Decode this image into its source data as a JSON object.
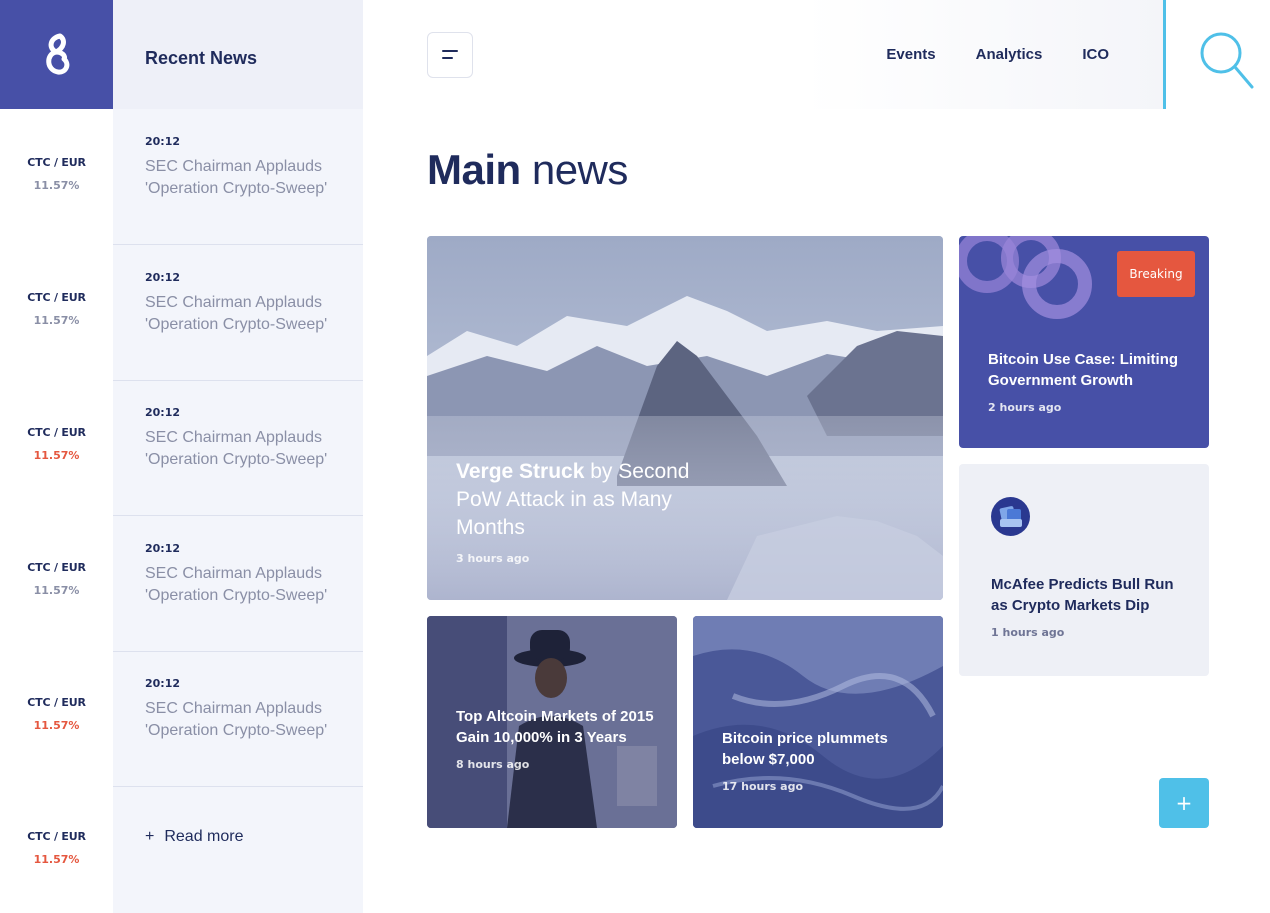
{
  "logo": {
    "icon": "logo-icon"
  },
  "ticker": [
    {
      "pair": "CTC / EUR",
      "change": "11.57%",
      "color": "#8a8fa6"
    },
    {
      "pair": "CTC / EUR",
      "change": "11.57%",
      "color": "#8a8fa6"
    },
    {
      "pair": "CTC / EUR",
      "change": "11.57%",
      "color": "#e5573f"
    },
    {
      "pair": "CTC / EUR",
      "change": "11.57%",
      "color": "#8a8fa6"
    },
    {
      "pair": "CTC / EUR",
      "change": "11.57%",
      "color": "#e5573f"
    },
    {
      "pair": "CTC / EUR",
      "change": "11.57%",
      "color": "#e5573f"
    }
  ],
  "recent": {
    "heading": "Recent News",
    "items": [
      {
        "time": "20:12",
        "title": "SEC Chairman Applauds 'Operation Crypto-Sweep'"
      },
      {
        "time": "20:12",
        "title": "SEC Chairman Applauds 'Operation Crypto-Sweep'"
      },
      {
        "time": "20:12",
        "title": "SEC Chairman Applauds 'Operation Crypto-Sweep'"
      },
      {
        "time": "20:12",
        "title": "SEC Chairman Applauds 'Operation Crypto-Sweep'"
      },
      {
        "time": "20:12",
        "title": "SEC Chairman Applauds 'Operation Crypto-Sweep'"
      }
    ],
    "read_more": "Read more",
    "read_more_symbol": "+"
  },
  "nav": {
    "items": [
      "Events",
      "Analytics",
      "ICO"
    ],
    "search_icon": "search-icon"
  },
  "main": {
    "title_bold": "Main",
    "title_rest": " news"
  },
  "cards": {
    "hero": {
      "title_bold": "Verge Struck",
      "title_rest": " by Second PoW Attack in as Many Months",
      "time": "3 hours ago"
    },
    "breaking": {
      "badge": "Breaking",
      "title": "Bitcoin Use Case: Limiting Government Growth",
      "time": "2 hours ago"
    },
    "mcafee": {
      "title": "McAfee Predicts Bull Run as Crypto Markets Dip",
      "time": "1 hours ago"
    },
    "altcoin": {
      "title": "Top Altcoin Markets of 2015 Gain 10,000% in 3 Years",
      "time": "8 hours ago"
    },
    "bitcoin": {
      "title": "Bitcoin price plummets below $7,000",
      "time": "17 hours ago"
    }
  },
  "add_button": "+",
  "colors": {
    "brand": "#4750a7",
    "accent": "#4fc0e8",
    "alert": "#e5573f"
  }
}
